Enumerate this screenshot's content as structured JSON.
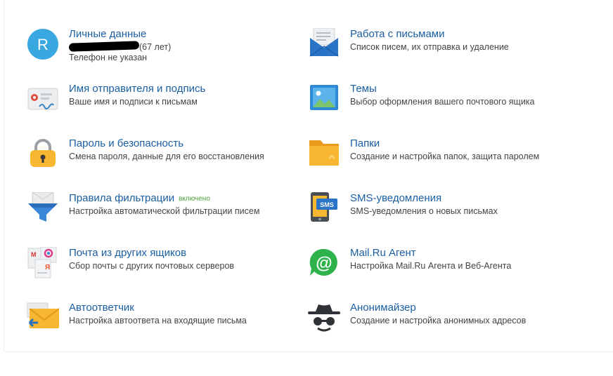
{
  "left": [
    {
      "title": "Личные данные",
      "age": "(67 лет)",
      "desc2": "Телефон не указан",
      "icon": "avatar-r-icon",
      "avatar_letter": "R"
    },
    {
      "title": "Имя отправителя и подпись",
      "desc": "Ваше имя и подписи к письмам",
      "icon": "signature-card-icon"
    },
    {
      "title": "Пароль и безопасность",
      "desc": "Смена пароля, данные для его восстановления",
      "icon": "padlock-icon"
    },
    {
      "title": "Правила фильтрации",
      "badge": "включено",
      "desc": "Настройка автоматической фильтрации писем",
      "icon": "filter-funnel-icon"
    },
    {
      "title": "Почта из других ящиков",
      "desc": "Сбор почты с других почтовых серверов",
      "icon": "other-mailboxes-icon"
    },
    {
      "title": "Автоответчик",
      "desc": "Настройка автоответа на входящие письма",
      "icon": "autoreply-envelope-icon"
    }
  ],
  "right": [
    {
      "title": "Работа с письмами",
      "desc": "Список писем, их отправка и удаление",
      "icon": "open-envelope-icon"
    },
    {
      "title": "Темы",
      "desc": "Выбор оформления вашего почтового ящика",
      "icon": "picture-icon"
    },
    {
      "title": "Папки",
      "desc": "Создание и настройка папок, защита паролем",
      "icon": "folder-icon"
    },
    {
      "title": "SMS-уведомления",
      "desc": "SMS-уведомления о новых письмах",
      "icon": "phone-sms-icon",
      "sms_label": "SMS"
    },
    {
      "title": "Mail.Ru Агент",
      "desc": "Настройка Mail.Ru Агента и Веб-Агента",
      "icon": "mail-agent-icon",
      "agent_glyph": "@"
    },
    {
      "title": "Анонимайзер",
      "desc": "Создание и настройка анонимных адресов",
      "icon": "incognito-icon"
    }
  ],
  "colors": {
    "link": "#1a5ea3",
    "text": "#444444",
    "badge": "#4aa33a",
    "avatar": "#3aa8e0"
  }
}
